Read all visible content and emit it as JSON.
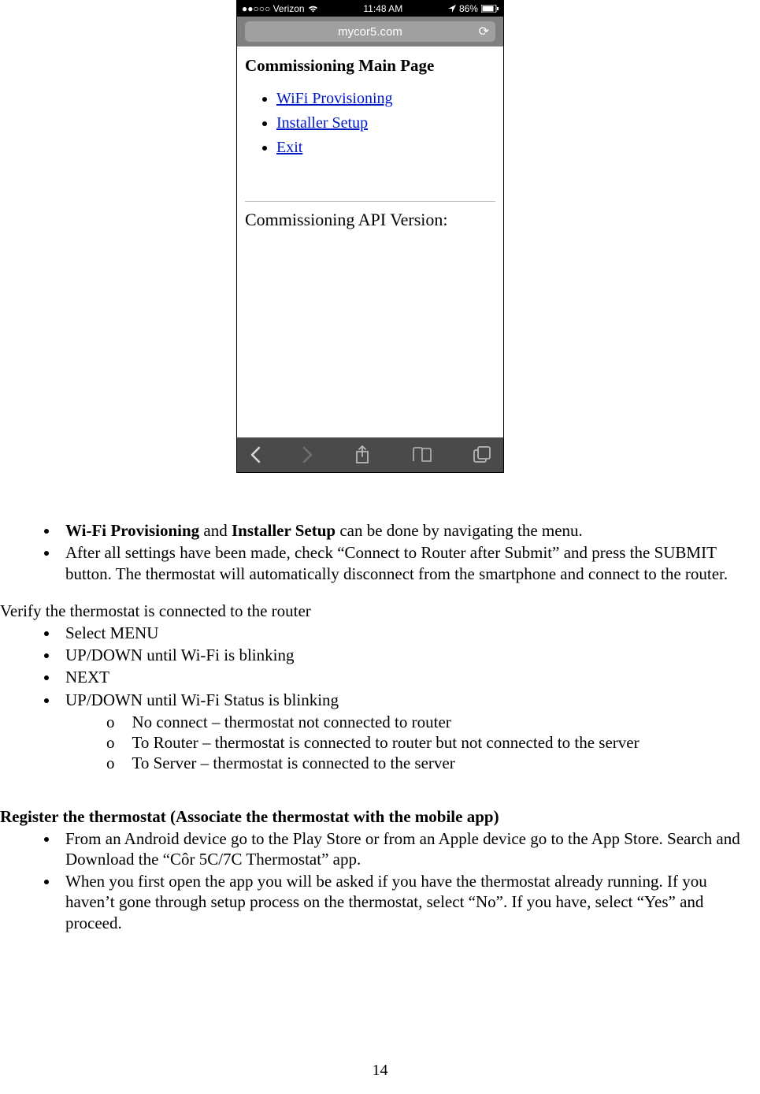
{
  "phone": {
    "status": {
      "carrier": "●●○○○ Verizon",
      "time": "11:48 AM",
      "battery": "86%"
    },
    "address": "mycor5.com",
    "title": "Commissioning Main Page",
    "links": {
      "wifi": "WiFi Provisioning",
      "installer": "Installer Setup",
      "exit": "Exit"
    },
    "api_line": "Commissioning API Version:"
  },
  "doc": {
    "bullet1_bold1": "Wi-Fi Provisioning",
    "bullet1_mid": " and ",
    "bullet1_bold2": "Installer Setup",
    "bullet1_tail": " can be done by navigating the menu.",
    "bullet2": "After all settings have been made, check “Connect to Router after Submit” and press the SUBMIT button.  The thermostat will automatically disconnect from the smartphone and connect to the router.",
    "verify_head": "Verify the thermostat is connected to the router",
    "steps": {
      "s1": "Select MENU",
      "s2": "UP/DOWN until Wi-Fi is blinking",
      "s3": "NEXT",
      "s4": "UP/DOWN until Wi-Fi Status is blinking"
    },
    "sub": {
      "a": "No connect – thermostat not connected to router",
      "b": "To Router – thermostat is connected to router but not connected to the server",
      "c": "To Server – thermostat is connected to the server"
    },
    "register_head": "Register the thermostat (Associate the thermostat with the mobile app)",
    "reg1": "From an Android device go to the Play Store or from an Apple device go to the App Store. Search and Download the  “Côr 5C/7C Thermostat” app.",
    "reg2": "When you first open the app you will be asked if you have the thermostat already running. If you haven’t gone through setup process on the thermostat, select “No”. If you have,  select “Yes” and proceed.",
    "page_number": "14"
  }
}
